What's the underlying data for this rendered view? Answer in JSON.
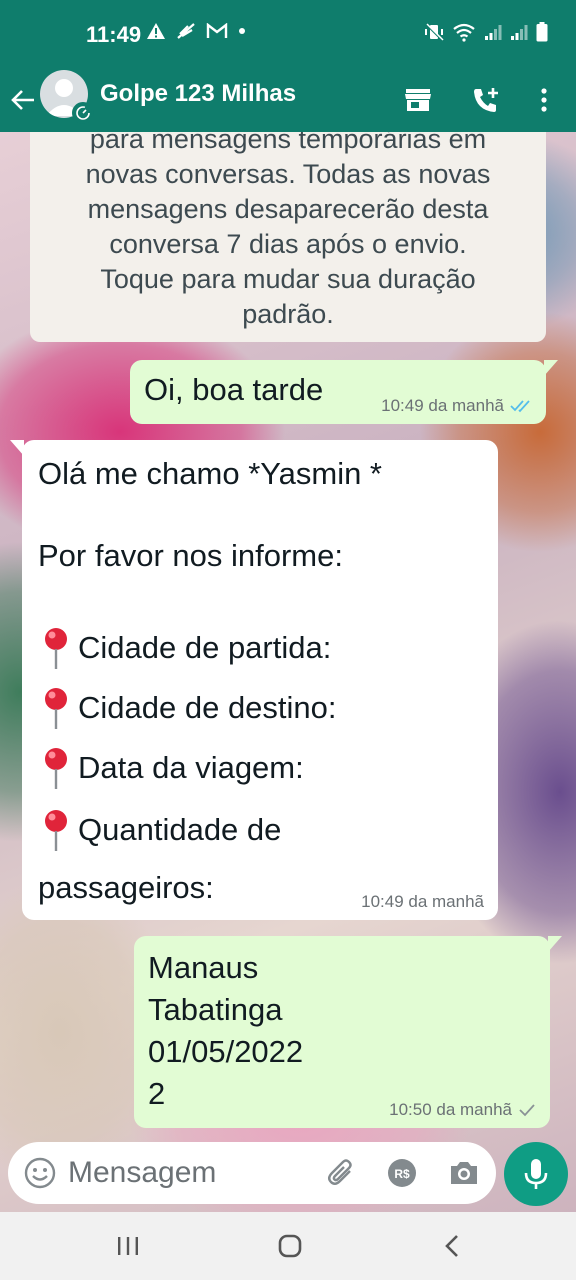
{
  "status_bar": {
    "time": "11:49",
    "left_icons": [
      "warning-icon",
      "feather-icon",
      "gmail-icon",
      "dot-icon"
    ],
    "right_icons": [
      "mute-vibrate-icon",
      "wifi-icon",
      "signal-icon",
      "signal-icon",
      "battery-icon"
    ]
  },
  "header": {
    "contact_name": "Golpe 123 Milhas",
    "actions": [
      "store-icon",
      "add-call-icon",
      "more-options-icon"
    ],
    "color": "#0f7d6c"
  },
  "system_message": {
    "lines": [
      "para mensagens temporárias em",
      "novas conversas. Todas as novas",
      "mensagens desaparecerão desta",
      "conversa 7 dias após o envio.",
      "Toque para mudar sua duração",
      "padrão."
    ]
  },
  "messages": [
    {
      "direction": "outgoing",
      "text": "Oi, boa tarde",
      "time": "10:49 da manhã",
      "status": "read"
    },
    {
      "direction": "incoming",
      "lines": [
        "Olá me chamo *Yasmin *",
        "Por favor nos informe:",
        "Cidade de partida:",
        "Cidade de destino:",
        "Data da viagem:",
        "Quantidade de",
        "passageiros:"
      ],
      "time": "10:49 da manhã"
    },
    {
      "direction": "outgoing",
      "lines": [
        "Manaus",
        "Tabatinga",
        "01/05/2022",
        "2"
      ],
      "time": "10:50 da manhã",
      "status": "sent"
    }
  ],
  "input": {
    "placeholder": "Mensagem",
    "icons": [
      "emoji-icon",
      "attach-icon",
      "payment-icon",
      "camera-icon"
    ]
  },
  "colors": {
    "accent": "#0f7d6c",
    "outgoing_bubble": "#e2fcd4",
    "incoming_bubble": "#ffffff",
    "read_ticks": "#53bdeb",
    "mic_button": "#0f9d84"
  }
}
